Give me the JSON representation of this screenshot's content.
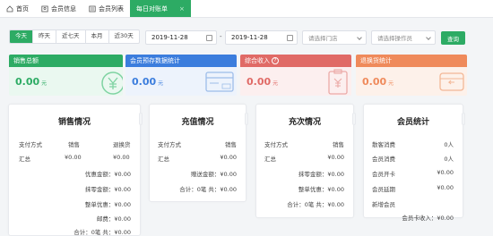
{
  "tabs": [
    {
      "label": "首页",
      "icon": "home-icon"
    },
    {
      "label": "会员信息",
      "icon": "member-icon"
    },
    {
      "label": "会员列表",
      "icon": "list-icon"
    },
    {
      "label": "每日对账单",
      "close": "×"
    }
  ],
  "filters": {
    "ranges": [
      "今天",
      "昨天",
      "近七天",
      "本月",
      "近30天"
    ],
    "date_start": "2019-11-28",
    "date_separator": "-",
    "date_end": "2019-11-28",
    "store_placeholder": "请选择门店",
    "operator_placeholder": "请选择操作员",
    "query_label": "查询"
  },
  "summary": [
    {
      "title": "销售总额",
      "amount": "0.00",
      "unit": "元",
      "color": "#2dab64",
      "bg": "#eaf8f0",
      "icon": "yuan-circle-icon"
    },
    {
      "title": "会员预存数据统计",
      "amount": "0.00",
      "unit": "元",
      "color": "#3b7ddd",
      "bg": "#edf3fc",
      "icon": "vip-card-icon"
    },
    {
      "title": "综合收入",
      "help": "?",
      "amount": "0.00",
      "unit": "元",
      "color": "#e06a66",
      "bg": "#fcefef",
      "icon": "clipboard-yuan-icon"
    },
    {
      "title": "退换货统计",
      "amount": "0.00",
      "unit": "元",
      "color": "#ef8a5b",
      "bg": "#fdf1ea",
      "icon": "return-wallet-icon"
    }
  ],
  "sales": {
    "title": "销售情况",
    "col_method": "支付方式",
    "col_sale": "销售",
    "col_refund": "退换货",
    "total_label": "汇总",
    "total_sale": "¥0.00",
    "total_refund": "¥0.00",
    "rows": [
      {
        "label": "优惠金额：",
        "value": "¥0.00"
      },
      {
        "label": "抹零金额：",
        "value": "¥0.00"
      },
      {
        "label": "整单优惠：",
        "value": "¥0.00"
      },
      {
        "label": "邮费：",
        "value": "¥0.00"
      }
    ],
    "footer": "合计：0笔 共：¥0.00"
  },
  "recharge": {
    "title": "充值情况",
    "col_method": "支付方式",
    "col_sale": "销售",
    "total_label": "汇总",
    "total_sale": "¥0.00",
    "rows": [
      {
        "label": "赠送金额：",
        "value": "¥0.00"
      }
    ],
    "footer": "合计：0笔 共：¥0.00"
  },
  "times": {
    "title": "充次情况",
    "col_method": "支付方式",
    "col_sale": "销售",
    "total_label": "汇总",
    "total_sale": "¥0.00",
    "rows": [
      {
        "label": "抹零金额：",
        "value": "¥0.00"
      },
      {
        "label": "整单优惠：",
        "value": "¥0.00"
      }
    ],
    "footer": "合计：0笔 共：¥0.00"
  },
  "members": {
    "title": "会员统计",
    "rows": [
      {
        "label": "散客消费",
        "value": "0人"
      },
      {
        "label": "会员消费",
        "value": "0人"
      },
      {
        "label": "会员开卡",
        "value": "¥0.00"
      },
      {
        "label": "会员延期",
        "value": "¥0.00"
      },
      {
        "label": "新增会员",
        "value": ""
      }
    ],
    "footer": "会员卡收入：¥0.00"
  }
}
